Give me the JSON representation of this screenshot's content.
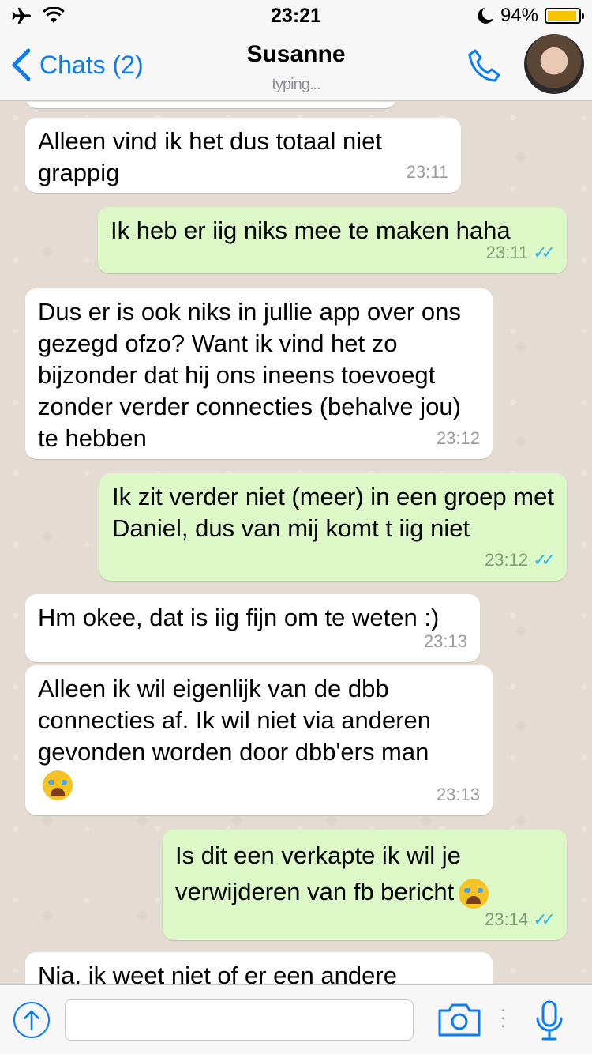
{
  "status_bar": {
    "time": "23:21",
    "battery": "94%",
    "battery_level": 0.94,
    "icons": [
      "airplane-icon",
      "wifi-icon",
      "moon-icon",
      "battery-icon"
    ]
  },
  "header": {
    "back_label": "Chats (2)",
    "contact_name": "Susanne",
    "status": "typing..."
  },
  "messages": [
    {
      "direction": "in",
      "text": "Alleen vind ik het dus totaal niet grappig",
      "time": "23:11"
    },
    {
      "direction": "out",
      "text": "Ik heb er iig niks mee te maken haha",
      "time": "23:11"
    },
    {
      "direction": "in",
      "text": "Dus er is ook niks in jullie app over ons gezegd ofzo? Want ik vind het zo bijzonder dat hij ons ineens toevoegt zonder verder connecties (behalve jou) te hebben",
      "time": "23:12"
    },
    {
      "direction": "out",
      "text": "Ik zit verder niet (meer) in een groep met Daniel, dus van mij komt t iig niet",
      "time": "23:12"
    },
    {
      "direction": "in",
      "text": "Hm okee, dat is iig fijn om te weten :)",
      "time": "23:13"
    },
    {
      "direction": "in",
      "text": "Alleen ik wil eigenlijk van de dbb connecties af. Ik wil niet via anderen gevonden worden door dbb'ers man",
      "time": "23:13"
    },
    {
      "direction": "out",
      "text": "Is dit een verkapte ik wil je verwijderen van fb bericht",
      "time": "23:14"
    },
    {
      "direction": "in",
      "text": "Nja, ik weet niet of er een andere",
      "time": ""
    }
  ],
  "input_bar": {
    "placeholder": ""
  },
  "colors": {
    "accent": "#0a7cf5",
    "outgoing_bubble": "#dcf8c6",
    "incoming_bubble": "#ffffff",
    "read_ticks": "#34b7f1",
    "chat_background": "#e4dcd2"
  }
}
